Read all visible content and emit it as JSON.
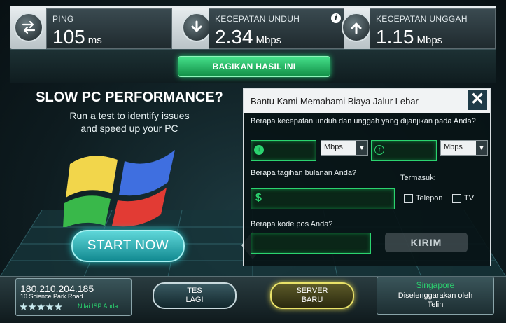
{
  "stats": {
    "ping": {
      "label": "PING",
      "value": "105",
      "unit": "ms"
    },
    "download": {
      "label": "KECEPATAN UNDUH",
      "value": "2.34",
      "unit": "Mbps"
    },
    "upload": {
      "label": "KECEPATAN UNGGAH",
      "value": "1.15",
      "unit": "Mbps"
    }
  },
  "share": {
    "label": "BAGIKAN HASIL INI"
  },
  "ad": {
    "title": "SLOW PC PERFORMANCE?",
    "subtitle_line1": "Run a test to identify issues",
    "subtitle_line2": "and speed up your PC",
    "button": "START NOW"
  },
  "survey": {
    "title": "Bantu Kami Memahami Biaya Jalur Lebar",
    "close": "✕",
    "q_speed": "Berapa kecepatan unduh dan unggah yang dijanjikan pada Anda?",
    "unit_down": "Mbps",
    "unit_up": "Mbps",
    "q_bill": "Berapa tagihan bulanan Anda?",
    "includes_label": "Termasuk:",
    "currency": "$",
    "opt_phone": "Telepon",
    "opt_tv": "TV",
    "q_zip": "Berapa kode pos Anda?",
    "submit": "KIRIM"
  },
  "bottom": {
    "ip": "180.210.204.185",
    "address": "10 Science Park Road",
    "stars": "★★★★★",
    "isp_rating_label": "Nilai ISP Anda",
    "retest_line1": "TES",
    "retest_line2": "LAGI",
    "newserver_line1": "SERVER",
    "newserver_line2": "BARU",
    "server_city": "Singapore",
    "hosted_by_line1": "Diselenggarakan oleh",
    "hosted_by_line2": "Telin"
  }
}
